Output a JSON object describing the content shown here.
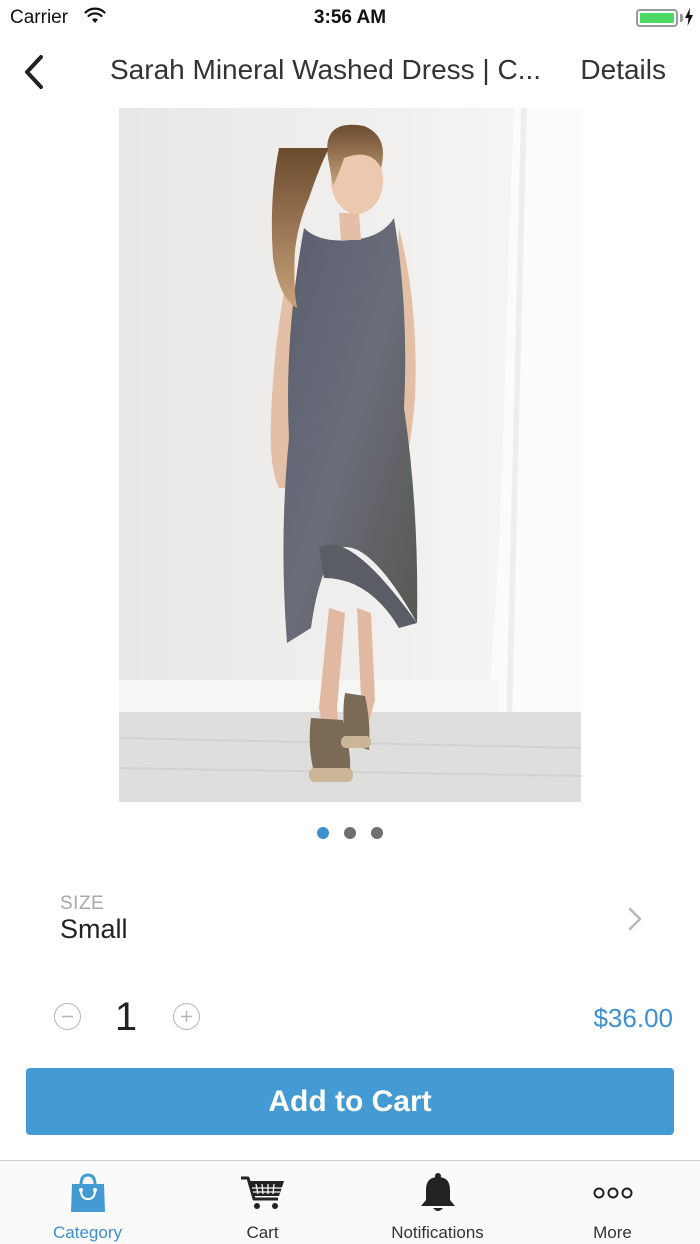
{
  "status_bar": {
    "carrier": "Carrier",
    "time": "3:56 AM",
    "battery_level": 1.0,
    "battery_color": "#4cd964"
  },
  "nav": {
    "back_icon": "chevron-left-icon",
    "title": "Sarah Mineral Washed Dress | C...",
    "action_label": "Details"
  },
  "gallery": {
    "image_count": 3,
    "active_index": 0
  },
  "size": {
    "label": "SIZE",
    "value": "Small"
  },
  "quantity": {
    "value": "1",
    "price": "$36.00"
  },
  "add_to_cart": {
    "label": "Add to Cart",
    "color": "#449bd4"
  },
  "tabs": [
    {
      "label": "Category",
      "icon": "shopping-bag-icon",
      "active": true
    },
    {
      "label": "Cart",
      "icon": "cart-icon",
      "active": false
    },
    {
      "label": "Notifications",
      "icon": "bell-icon",
      "active": false
    },
    {
      "label": "More",
      "icon": "more-icon",
      "active": false
    }
  ],
  "colors": {
    "accent": "#3d8fd0",
    "inactive_dot": "#6d6f73"
  }
}
